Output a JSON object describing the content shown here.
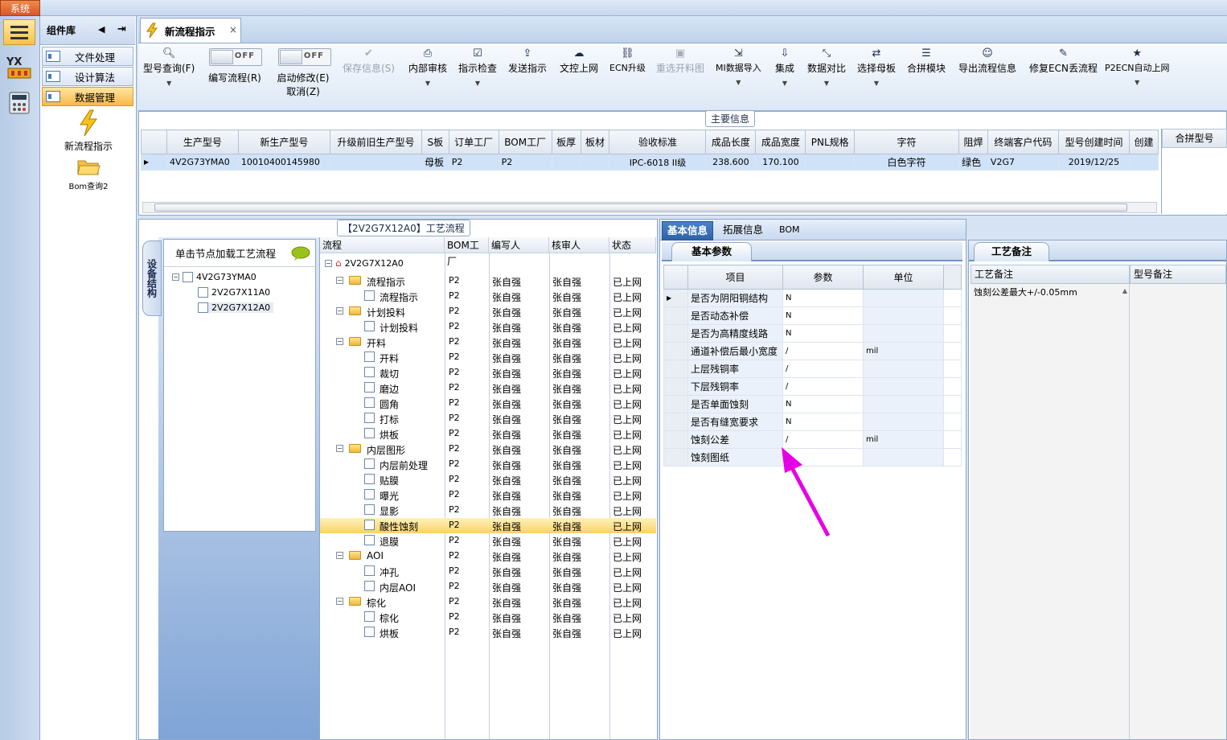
{
  "system_menu": "系统",
  "sidebar": {
    "title": "组件库",
    "items": [
      {
        "label": "文件处理"
      },
      {
        "label": "设计算法"
      },
      {
        "label": "数据管理"
      }
    ],
    "big_items": [
      {
        "label": "新流程指示"
      },
      {
        "label": "Bom查询2"
      }
    ],
    "rail_badge": "YX"
  },
  "doc_tab": {
    "label": "新流程指示",
    "close": "×"
  },
  "ribbon": {
    "buttons": [
      {
        "label": "型号查询(F)",
        "icon": "search-icon"
      },
      {
        "label": "保存信息(S)",
        "icon": "check-icon"
      },
      {
        "label": "内部审核",
        "icon": "print-icon"
      },
      {
        "label": "指示检查",
        "icon": "checkbox-icon"
      },
      {
        "label": "发送指示",
        "icon": "upload-icon"
      },
      {
        "label": "文控上网",
        "icon": "cloud-upload-icon"
      },
      {
        "label": "ECN升级",
        "icon": "ecn-icon"
      },
      {
        "label": "重选开料图",
        "icon": "image-icon"
      },
      {
        "label": "MI数据导入",
        "icon": "import-icon"
      },
      {
        "label": "集成",
        "icon": "download-icon"
      },
      {
        "label": "数据对比",
        "icon": "compare-icon"
      },
      {
        "label": "选择母板",
        "icon": "shuffle-icon"
      },
      {
        "label": "合拼模块",
        "icon": "list-icon"
      },
      {
        "label": "导出流程信息",
        "icon": "smile-icon"
      },
      {
        "label": "修复ECN丢流程",
        "icon": "wrench-icon"
      },
      {
        "label": "P2ECN自动上网",
        "icon": "star-icon"
      }
    ],
    "toggles": [
      {
        "label": "编写流程(R)",
        "state": "OFF"
      },
      {
        "label": "启动修改(E)",
        "label2": "取消(Z)",
        "state": "OFF"
      }
    ]
  },
  "main_info": {
    "title": "主要信息",
    "columns": [
      "生产型号",
      "新生产型号",
      "升级前旧生产型号",
      "S板",
      "订单工厂",
      "BOM工厂",
      "板厚",
      "板材",
      "验收标准",
      "成品长度",
      "成品宽度",
      "PNL规格",
      "字符",
      "阻焊",
      "终端客户代码",
      "型号创建时间",
      "创建"
    ],
    "row": [
      "4V2G73YMA0",
      "10010400145980",
      "",
      "母板",
      "P2",
      "P2",
      "",
      "",
      "IPC-6018 II级",
      "238.600",
      "170.100",
      "",
      "白色字符",
      "绿色",
      "V2G7",
      "2019/12/25",
      ""
    ],
    "side_header": "合拼型号"
  },
  "process": {
    "title": "【2V2G7X12A0】工艺流程",
    "vertical_tab": "设备结构",
    "tree_header": "单击节点加载工艺流程",
    "tree": [
      "4V2G73YMA0",
      "2V2G7X11A0",
      "2V2G7X12A0"
    ],
    "columns": [
      "流程",
      "BOM工厂",
      "编写人",
      "核审人",
      "状态"
    ],
    "root": "2V2G7X12A0",
    "rows": [
      {
        "name": "流程指示",
        "folder": true
      },
      {
        "name": "流程指示",
        "folder": false
      },
      {
        "name": "计划投料",
        "folder": true
      },
      {
        "name": "计划投料",
        "folder": false
      },
      {
        "name": "开料",
        "folder": true
      },
      {
        "name": "开料",
        "folder": false
      },
      {
        "name": "裁切",
        "folder": false
      },
      {
        "name": "磨边",
        "folder": false
      },
      {
        "name": "圆角",
        "folder": false
      },
      {
        "name": "打标",
        "folder": false
      },
      {
        "name": "烘板",
        "folder": false
      },
      {
        "name": "内层图形",
        "folder": true
      },
      {
        "name": "内层前处理",
        "folder": false
      },
      {
        "name": "贴膜",
        "folder": false
      },
      {
        "name": "曝光",
        "folder": false
      },
      {
        "name": "显影",
        "folder": false
      },
      {
        "name": "酸性蚀刻",
        "folder": false,
        "selected": true
      },
      {
        "name": "退膜",
        "folder": false
      },
      {
        "name": "AOI",
        "folder": true
      },
      {
        "name": "冲孔",
        "folder": false
      },
      {
        "name": "内层AOI",
        "folder": false
      },
      {
        "name": "棕化",
        "folder": true
      },
      {
        "name": "棕化",
        "folder": false
      },
      {
        "name": "烘板",
        "folder": false
      }
    ],
    "factory": "P2",
    "writer": "张自强",
    "reviewer": "张自强",
    "status": "已上网"
  },
  "detail": {
    "tabs": [
      "基本信息",
      "拓展信息",
      "BOM"
    ],
    "subtab": "基本参数",
    "columns": [
      "项目",
      "参数",
      "单位"
    ],
    "rows": [
      {
        "item": "是否为阴阳铜结构",
        "param": "N",
        "unit": ""
      },
      {
        "item": "是否动态补偿",
        "param": "N",
        "unit": ""
      },
      {
        "item": "是否为高精度线路",
        "param": "N",
        "unit": ""
      },
      {
        "item": "通道补偿后最小宽度",
        "param": "/",
        "unit": "mil"
      },
      {
        "item": "上层残铜率",
        "param": "/",
        "unit": ""
      },
      {
        "item": "下层残铜率",
        "param": "/",
        "unit": ""
      },
      {
        "item": "是否单面蚀刻",
        "param": "N",
        "unit": ""
      },
      {
        "item": "是否有缝宽要求",
        "param": "N",
        "unit": ""
      },
      {
        "item": "蚀刻公差",
        "param": "/",
        "unit": "mil"
      },
      {
        "item": "蚀刻图纸",
        "param": "",
        "unit": ""
      }
    ]
  },
  "notes": {
    "tab": "工艺备注",
    "col1": "工艺备注",
    "col2": "型号备注",
    "note": "蚀刻公差最大+/-0.05mm"
  },
  "colors": {
    "arrow": "#e600e6",
    "selected_row": "#f8d26a",
    "accent": "#2f63a7"
  }
}
